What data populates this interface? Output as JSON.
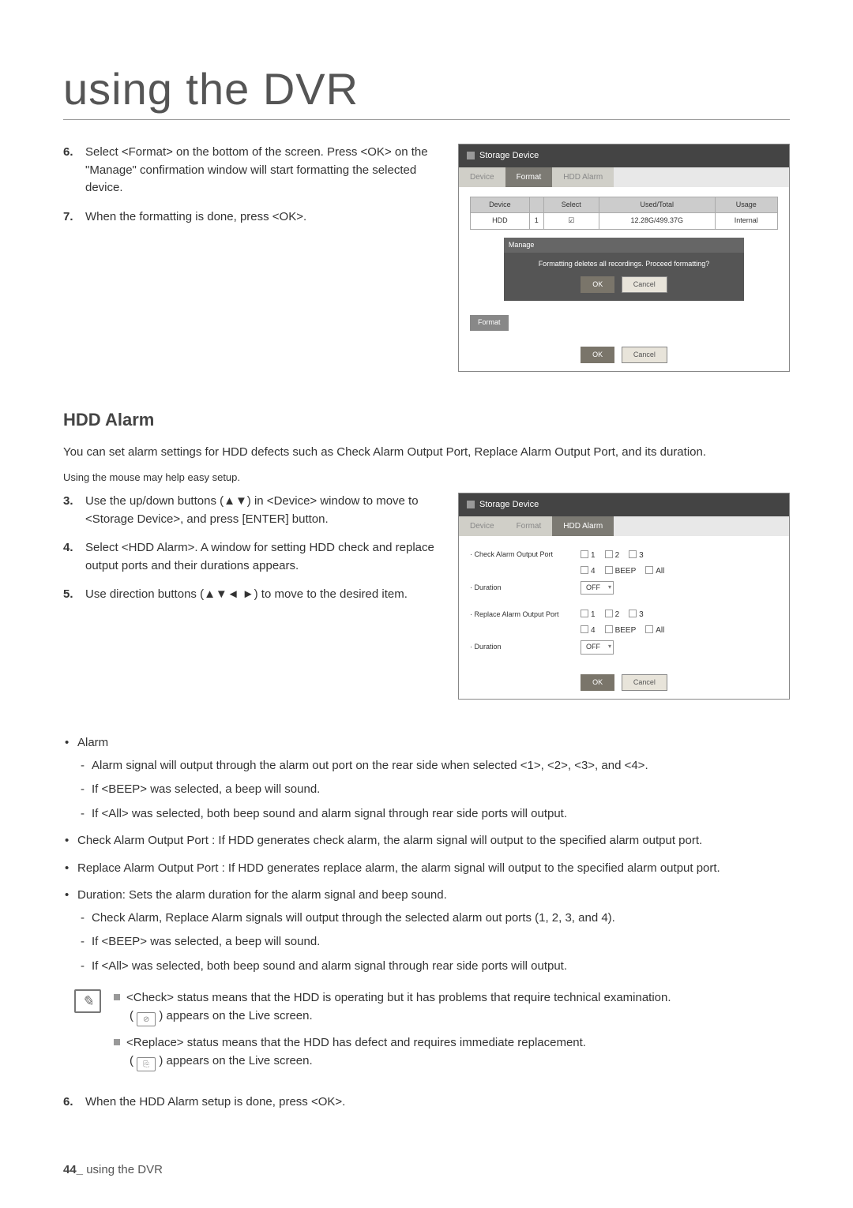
{
  "page_title": "using the DVR",
  "steps_a": [
    {
      "num": "6.",
      "text": "Select <Format> on the bottom of the screen. Press <OK> on the \"Manage\" confirmation window will start formatting the selected device."
    },
    {
      "num": "7.",
      "text": "When the formatting is done, press <OK>."
    }
  ],
  "mock1": {
    "win_title": "Storage Device",
    "tabs": [
      "Device",
      "Format",
      "HDD Alarm"
    ],
    "active_tab": "Format",
    "table_headers": [
      "Device",
      "",
      "Select",
      "Used/Total",
      "Usage"
    ],
    "table_row": [
      "HDD",
      "1",
      "☑",
      "12.28G/499.37G",
      "Internal"
    ],
    "dialog_title": "Manage",
    "dialog_msg": "Formatting deletes all recordings. Proceed formatting?",
    "ok": "OK",
    "cancel": "Cancel",
    "format_btn": "Format"
  },
  "section_title": "HDD Alarm",
  "section_intro": "You can set alarm settings for HDD defects such as Check Alarm Output Port, Replace Alarm Output Port, and its duration.",
  "section_hint": "Using the mouse may help easy setup.",
  "steps_b": [
    {
      "num": "3.",
      "text": "Use the up/down buttons (▲▼) in <Device> window to move to <Storage Device>, and press [ENTER] button."
    },
    {
      "num": "4.",
      "text": "Select <HDD Alarm>. A window for setting HDD check and replace output ports and their durations appears."
    },
    {
      "num": "5.",
      "text": "Use direction buttons (▲▼◄ ►) to move to the desired item."
    }
  ],
  "mock2": {
    "win_title": "Storage Device",
    "tabs": [
      "Device",
      "Format",
      "HDD Alarm"
    ],
    "active_tab": "HDD Alarm",
    "rows": [
      {
        "label": "· Check Alarm Output Port",
        "checks": [
          "1",
          "2",
          "3",
          "4",
          "BEEP",
          "All"
        ]
      },
      {
        "label": "· Duration",
        "select": "OFF"
      },
      {
        "label": "· Replace Alarm Output Port",
        "checks": [
          "1",
          "2",
          "3",
          "4",
          "BEEP",
          "All"
        ]
      },
      {
        "label": "· Duration",
        "select": "OFF"
      }
    ],
    "ok": "OK",
    "cancel": "Cancel"
  },
  "bullets": [
    {
      "text": "Alarm",
      "dashes": [
        "Alarm signal will output through the alarm out port on the rear side when selected <1>, <2>, <3>, and <4>.",
        "If <BEEP> was selected, a beep will sound.",
        "If <All> was selected, both beep sound and alarm signal through rear side ports will output."
      ]
    },
    {
      "text": "Check Alarm Output Port : If HDD generates check alarm, the alarm signal will output to the specified alarm output port."
    },
    {
      "text": "Replace Alarm Output Port : If HDD generates replace alarm, the alarm signal will output to the specified alarm output port."
    },
    {
      "text": "Duration: Sets the alarm duration for the alarm signal and beep sound.",
      "dashes": [
        "Check Alarm, Replace Alarm signals will output through the selected alarm out ports (1, 2, 3, and 4).",
        "If <BEEP> was selected, a beep will sound.",
        "If <All> was selected, both beep sound and alarm signal through rear side ports will output."
      ]
    }
  ],
  "notes": [
    {
      "head": "<Check> status means that the HDD is operating but it has problems that require technical examination.",
      "sub": "appears on the Live screen."
    },
    {
      "head": "<Replace> status means that the HDD has defect and requires immediate replacement.",
      "sub": "appears on the Live screen."
    }
  ],
  "step6": {
    "num": "6.",
    "text": "When the HDD Alarm setup is done, press <OK>."
  },
  "footer_num": "44_",
  "footer_text": "using the DVR"
}
